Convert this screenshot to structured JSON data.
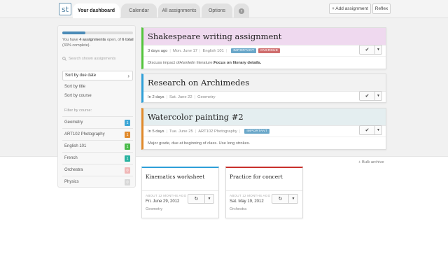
{
  "app": {
    "logo_text": "st"
  },
  "tabs": [
    {
      "label": "Your dashboard"
    },
    {
      "label": "Calendar"
    },
    {
      "label": "All assignments"
    },
    {
      "label": "Options"
    }
  ],
  "toolbar": {
    "add_label": "+ Add assignment",
    "reflex_label": "Reflex"
  },
  "sidebar": {
    "progress_percent": 33,
    "summary_pre": "You have ",
    "summary_count": "4 assignments",
    "summary_mid": " open, of ",
    "summary_total": "6 total",
    "summary_post": " (33% complete).",
    "search_placeholder": "Search shown assignments",
    "sort": [
      {
        "label": "Sort by due date"
      },
      {
        "label": "Sort by title"
      },
      {
        "label": "Sort by course"
      }
    ],
    "filter_label": "Filter by course:",
    "courses": [
      {
        "name": "Geometry",
        "count": "1",
        "color": "#3fa7d6"
      },
      {
        "name": "ART102 Photography",
        "count": "1",
        "color": "#e08a2c"
      },
      {
        "name": "English 101",
        "count": "1",
        "color": "#4cbb4c"
      },
      {
        "name": "French",
        "count": "1",
        "color": "#2bb3a1"
      },
      {
        "name": "Orchestra",
        "count": "0",
        "color": "#f0b7b7"
      },
      {
        "name": "Physics",
        "count": "0",
        "color": "#d8d8d8"
      }
    ]
  },
  "assignments": [
    {
      "title": "Shakespeare writing assignment",
      "when": "3 days ago",
      "date": "Mon. June 17",
      "course": "English 101",
      "badges": [
        {
          "text": "IMPORTANT",
          "color": "#6aa7c9"
        },
        {
          "text": "OVERDUE",
          "color": "#cf6d6d"
        }
      ],
      "desc_pre": "Discuss impact of ",
      "desc_em": "Hamlet",
      "desc_mid": " in literature. ",
      "desc_bold": "Focus on literary details.",
      "accent": "#53c43b",
      "title_bg": "#efd9ef"
    },
    {
      "title": "Research on Archimedes",
      "when": "In 2 days",
      "date": "Sat. June 22",
      "course": "Geometry",
      "accent": "#2e9fd8",
      "title_bg": "#f2f2f2"
    },
    {
      "title": "Watercolor painting #2",
      "when": "In 5 days",
      "date": "Tue. June 25",
      "course": "ART102 Photography",
      "badges": [
        {
          "text": "IMPORTANT",
          "color": "#6aa7c9"
        }
      ],
      "desc": "Major grade, due at beginning of class. Use long strokes.",
      "accent": "#e0892a",
      "title_bg": "#e4eef0"
    }
  ],
  "bulk_archive": "+ Bulk archive",
  "completed": [
    {
      "title": "Kinematics worksheet",
      "ago": "ABOUT 12 MONTHS AGO",
      "date": "Fri. June 29, 2012",
      "course": "Geometry",
      "accent": "#2e9fd8"
    },
    {
      "title": "Practice for concert",
      "ago": "ABOUT 12 MONTHS AGO",
      "date": "Sat. May 19, 2012",
      "course": "Orchestra",
      "accent": "#c9302c"
    }
  ],
  "icons": {
    "check": "check-icon",
    "undo": "undo-icon",
    "caret": "caret-down-icon",
    "help": "question-icon",
    "search": "search-icon",
    "chevron": "chevron-right-icon"
  }
}
